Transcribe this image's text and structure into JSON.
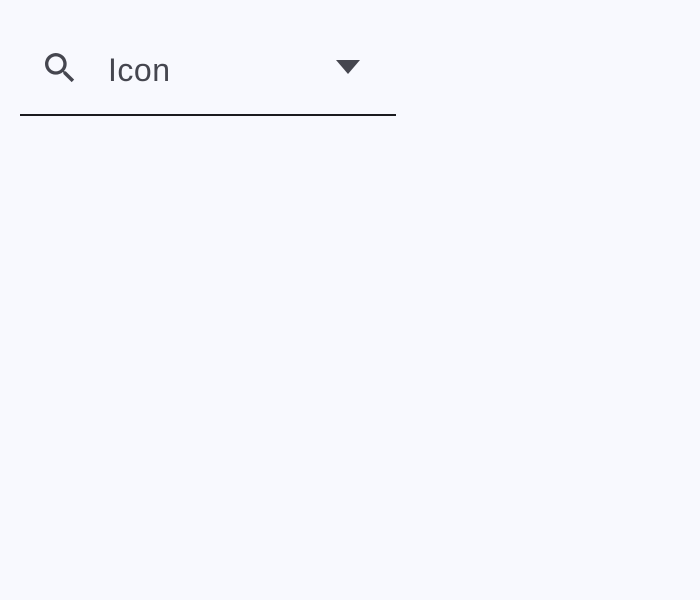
{
  "dropdown": {
    "value": "Icon",
    "leading_icon": "search-icon",
    "trailing_icon": "arrow-drop-down-icon"
  },
  "colors": {
    "background": "#f8f9fe",
    "text": "#45464f",
    "icon": "#45464f",
    "underline": "#1b1b1f"
  }
}
